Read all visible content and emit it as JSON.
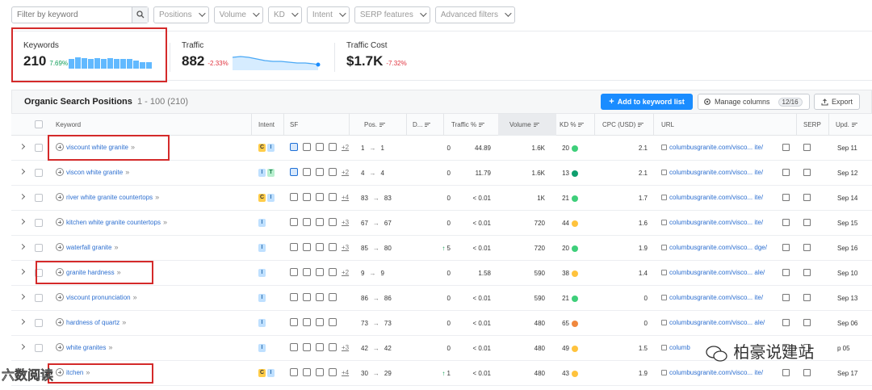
{
  "filters": {
    "search_placeholder": "Filter by keyword",
    "dropdowns": [
      "Positions",
      "Volume",
      "KD",
      "Intent",
      "SERP features",
      "Advanced filters"
    ]
  },
  "summary": {
    "keywords": {
      "label": "Keywords",
      "value": "210",
      "change": "7.69%",
      "bars": [
        0.85,
        1.0,
        0.9,
        0.85,
        0.9,
        0.85,
        0.9,
        0.85,
        0.85,
        0.85,
        0.75,
        0.55,
        0.6
      ]
    },
    "traffic": {
      "label": "Traffic",
      "value": "882",
      "change": "-2.33%"
    },
    "traffic_cost": {
      "label": "Traffic Cost",
      "value": "$1.7K",
      "change": "-7.32%"
    }
  },
  "positions_header": {
    "title": "Organic Search Positions",
    "range": "1 - 100 (210)",
    "add_button": "Add to keyword list",
    "manage_button": "Manage columns",
    "manage_count": "12/16",
    "export_button": "Export"
  },
  "columns": {
    "keyword": "Keyword",
    "intent": "Intent",
    "sf": "SF",
    "pos": "Pos.",
    "diff": "D...",
    "traffic_pct": "Traffic %",
    "volume": "Volume",
    "kd": "KD %",
    "cpc": "CPC (USD)",
    "url": "URL",
    "serp": "SERP",
    "upd": "Upd."
  },
  "rows": [
    {
      "keyword": "viscount white granite",
      "intent": [
        "C",
        "I"
      ],
      "sf_more": "+2",
      "pos_from": "1",
      "pos_to": "1",
      "diff": "0",
      "diff_up": false,
      "traffic": "44.89",
      "volume": "1.6K",
      "kd": "20",
      "kd_color": "#3ecf7a",
      "cpc": "2.1",
      "url": "columbusgranite.com/visco... ite/",
      "upd": "Sep 11"
    },
    {
      "keyword": "viscon white granite",
      "intent": [
        "I",
        "T"
      ],
      "sf_more": "+2",
      "pos_from": "4",
      "pos_to": "4",
      "diff": "0",
      "diff_up": false,
      "traffic": "11.79",
      "volume": "1.6K",
      "kd": "13",
      "kd_color": "#0f9f6e",
      "cpc": "2.1",
      "url": "columbusgranite.com/visco... ite/",
      "upd": "Sep 12"
    },
    {
      "keyword": "river white granite countertops",
      "intent": [
        "C",
        "I"
      ],
      "sf_more": "+4",
      "pos_from": "83",
      "pos_to": "83",
      "diff": "0",
      "diff_up": false,
      "traffic": "< 0.01",
      "volume": "1K",
      "kd": "21",
      "kd_color": "#3ecf7a",
      "cpc": "1.7",
      "url": "columbusgranite.com/visco... ite/",
      "upd": "Sep 14"
    },
    {
      "keyword": "kitchen white granite countertops",
      "intent": [
        "I"
      ],
      "sf_more": "+3",
      "pos_from": "67",
      "pos_to": "67",
      "diff": "0",
      "diff_up": false,
      "traffic": "< 0.01",
      "volume": "720",
      "kd": "44",
      "kd_color": "#ffc33d",
      "cpc": "1.6",
      "url": "columbusgranite.com/visco... ite/",
      "upd": "Sep 15"
    },
    {
      "keyword": "waterfall granite",
      "intent": [
        "I"
      ],
      "sf_more": "+3",
      "pos_from": "85",
      "pos_to": "80",
      "diff": "5",
      "diff_up": true,
      "traffic": "< 0.01",
      "volume": "720",
      "kd": "20",
      "kd_color": "#3ecf7a",
      "cpc": "1.9",
      "url": "columbusgranite.com/visco... dge/",
      "upd": "Sep 16"
    },
    {
      "keyword": "granite hardness",
      "intent": [
        "I"
      ],
      "sf_more": "+2",
      "pos_from": "9",
      "pos_to": "9",
      "diff": "0",
      "diff_up": false,
      "traffic": "1.58",
      "volume": "590",
      "kd": "38",
      "kd_color": "#ffc33d",
      "cpc": "1.4",
      "url": "columbusgranite.com/visco... ale/",
      "upd": "Sep 10"
    },
    {
      "keyword": "viscount pronunciation",
      "intent": [
        "I"
      ],
      "sf_more": "",
      "pos_from": "86",
      "pos_to": "86",
      "diff": "0",
      "diff_up": false,
      "traffic": "< 0.01",
      "volume": "590",
      "kd": "21",
      "kd_color": "#3ecf7a",
      "cpc": "0",
      "url": "columbusgranite.com/visco... ite/",
      "upd": "Sep 13"
    },
    {
      "keyword": "hardness of quartz",
      "intent": [
        "I"
      ],
      "sf_more": "",
      "pos_from": "73",
      "pos_to": "73",
      "diff": "0",
      "diff_up": false,
      "traffic": "< 0.01",
      "volume": "480",
      "kd": "65",
      "kd_color": "#f0883e",
      "cpc": "0",
      "url": "columbusgranite.com/visco... ale/",
      "upd": "Sep 06"
    },
    {
      "keyword": "white granites",
      "intent": [
        "I"
      ],
      "sf_more": "+3",
      "pos_from": "42",
      "pos_to": "42",
      "diff": "0",
      "diff_up": false,
      "traffic": "< 0.01",
      "volume": "480",
      "kd": "49",
      "kd_color": "#ffc33d",
      "cpc": "1.5",
      "url": "columb",
      "upd": "p 05"
    },
    {
      "keyword": "itchen",
      "intent": [
        "C",
        "I"
      ],
      "sf_more": "+4",
      "pos_from": "30",
      "pos_to": "29",
      "diff": "1",
      "diff_up": true,
      "traffic": "< 0.01",
      "volume": "480",
      "kd": "43",
      "kd_color": "#ffc33d",
      "cpc": "1.9",
      "url": "columbusgranite.com/visco... ite/",
      "upd": "Sep 17"
    }
  ],
  "watermark": {
    "right": "柏豪说建站",
    "left": "六数阅读"
  }
}
